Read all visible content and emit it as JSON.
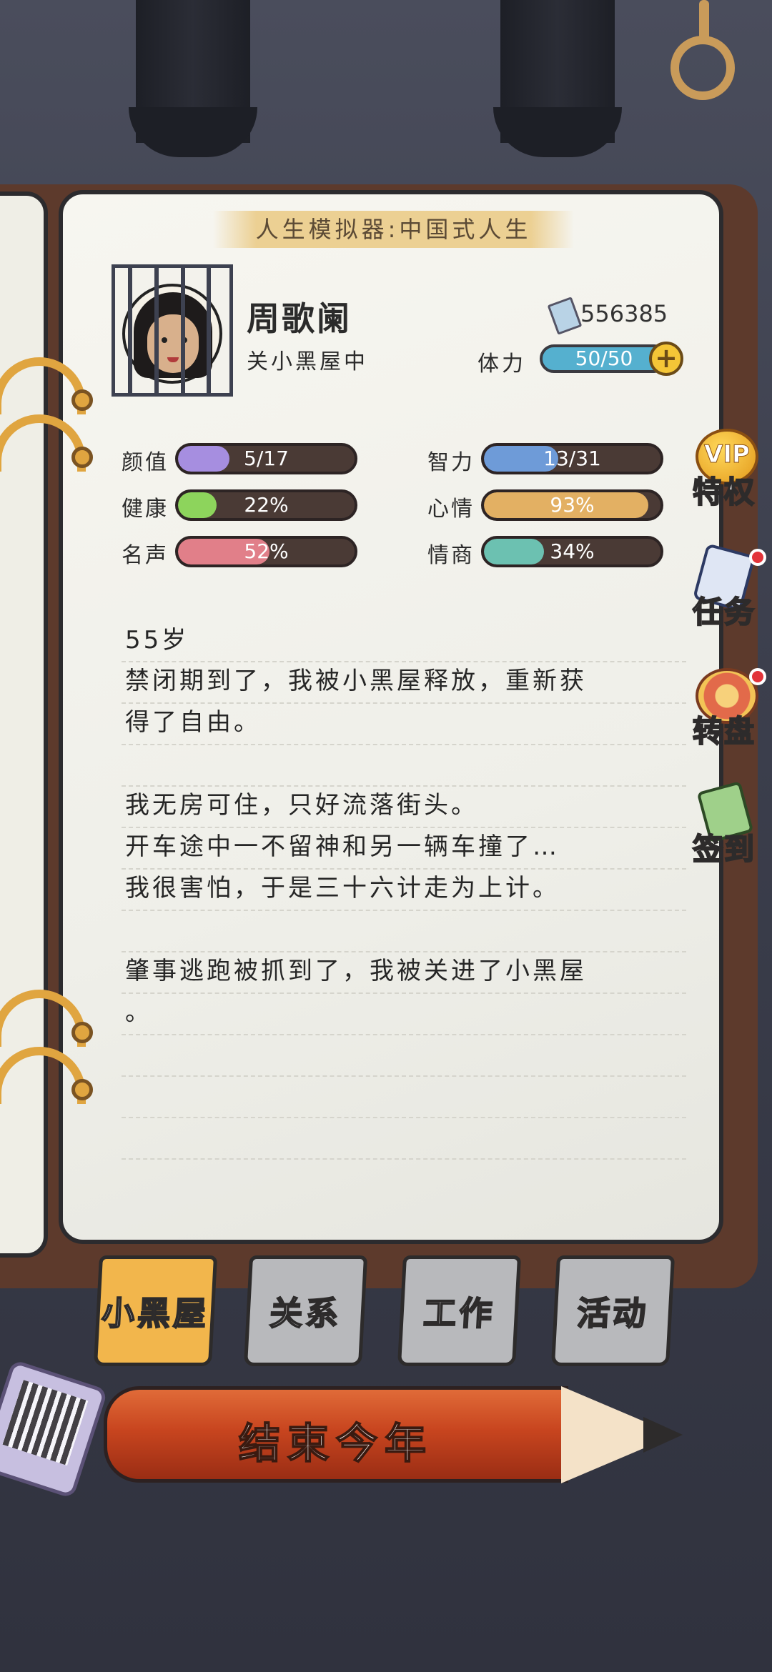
{
  "game_title": "人生模拟器:中国式人生",
  "character": {
    "name": "周歌阑",
    "status": "关小黑屋中",
    "money": "556385",
    "stamina_label": "体力",
    "stamina_value": "50/50",
    "stamina_fraction": 1.0
  },
  "attributes": [
    {
      "label": "颜值",
      "value": "5/17",
      "fraction": 0.29,
      "color": "#a68ee0"
    },
    {
      "label": "智力",
      "value": "13/31",
      "fraction": 0.42,
      "color": "#6e9bd8"
    },
    {
      "label": "健康",
      "value": "22%",
      "fraction": 0.22,
      "color": "#8dd45c"
    },
    {
      "label": "心情",
      "value": "93%",
      "fraction": 0.93,
      "color": "#e3b063"
    },
    {
      "label": "名声",
      "value": "52%",
      "fraction": 0.52,
      "color": "#e17f89"
    },
    {
      "label": "情商",
      "value": "34%",
      "fraction": 0.34,
      "color": "#6cc1b1"
    }
  ],
  "journal": {
    "age": "55岁",
    "lines": [
      "禁闭期到了，我被小黑屋释放，重新获",
      "得了自由。",
      "",
      "我无房可住，只好流落街头。",
      "开车途中一不留神和另一辆车撞了…",
      "我很害怕，于是三十六计走为上计。",
      "",
      "肇事逃跑被抓到了，我被关进了小黑屋",
      "。"
    ]
  },
  "side_menu": [
    {
      "label": "特权",
      "icon": "vip-badge-icon",
      "icon_text": "VIP",
      "badge": false
    },
    {
      "label": "任务",
      "icon": "clipboard-icon",
      "badge": true
    },
    {
      "label": "转盘",
      "icon": "wheel-icon",
      "badge": true
    },
    {
      "label": "签到",
      "icon": "checkin-pencil-icon",
      "badge": false
    }
  ],
  "tabs": [
    {
      "label": "小黑屋",
      "active": true
    },
    {
      "label": "关系",
      "active": false
    },
    {
      "label": "工作",
      "active": false
    },
    {
      "label": "活动",
      "active": false
    }
  ],
  "end_year_button": "结束今年",
  "colors": {
    "stamina": "#55b0cf",
    "tab_active": "#f2b64c",
    "tab_inactive": "#b8b9bc",
    "pencil": "#c8451f",
    "badge": "#e2343a"
  }
}
